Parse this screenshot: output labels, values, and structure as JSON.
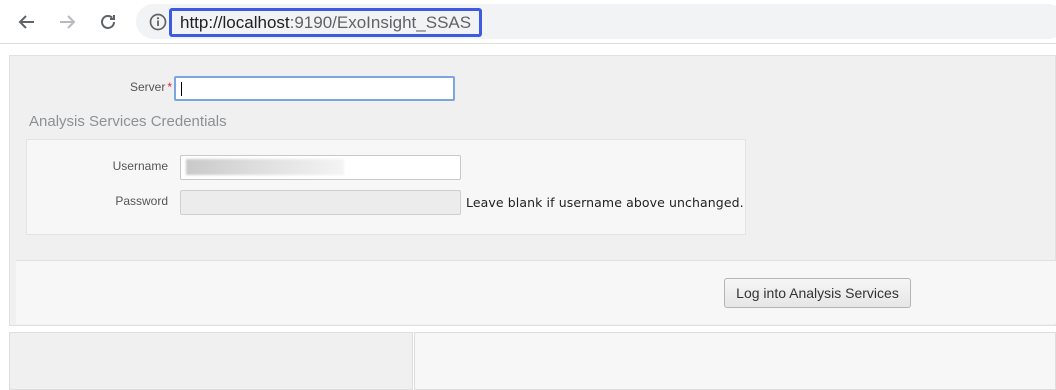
{
  "browser": {
    "url_host": "http://localhost",
    "url_rest": ":9190/ExoInsight_SSAS",
    "icons": {
      "back": "back-arrow-icon",
      "forward": "forward-arrow-icon",
      "reload": "reload-icon",
      "info": "info-icon"
    }
  },
  "form": {
    "server_label": "Server",
    "required_marker": "*",
    "server_value": "",
    "credentials_title": "Analysis Services Credentials",
    "username_label": "Username",
    "password_label": "Password",
    "password_hint": "Leave blank if username above unchanged.",
    "login_button": "Log into Analysis Services"
  },
  "colors": {
    "url_highlight": "#3d5be0",
    "required": "#d9262f",
    "focus_border": "#78a6dd"
  }
}
